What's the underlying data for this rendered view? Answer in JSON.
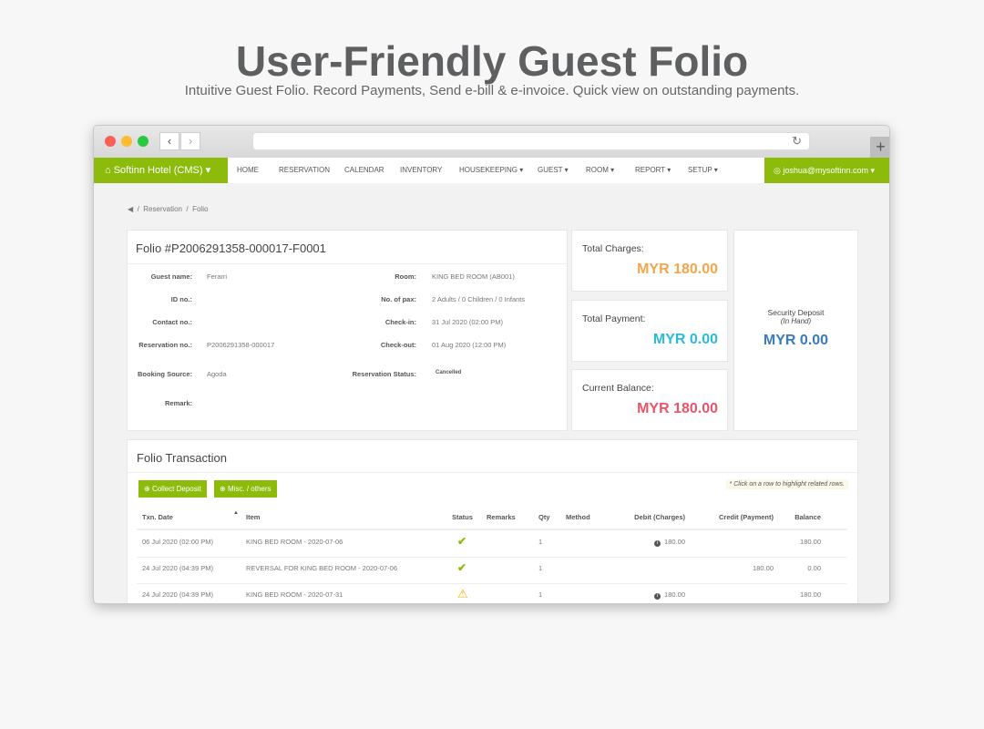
{
  "headline": "User-Friendly Guest Folio",
  "subheadline": "Intuitive Guest Folio. Record Payments, Send e-bill & e-invoice. Quick view on outstanding payments.",
  "nav": {
    "brand": "Softinn Hotel (CMS)",
    "items": [
      "HOME",
      "RESERVATION",
      "CALENDAR",
      "INVENTORY",
      "HOUSEKEEPING ▾",
      "GUEST ▾",
      "ROOM ▾",
      "REPORT ▾",
      "SETUP ▾"
    ],
    "user": "joshua@mysoftinn.com"
  },
  "breadcrumb": {
    "items": [
      "Reservation",
      "Folio"
    ]
  },
  "folio": {
    "title": "Folio #P2006291358-000017-F0001",
    "left": [
      {
        "label": "Guest name:",
        "value": "Ferarri"
      },
      {
        "label": "ID no.:",
        "value": ""
      },
      {
        "label": "Contact no.:",
        "value": ""
      },
      {
        "label": "Reservation no.:",
        "value": "P2006291358-000017"
      },
      {
        "label": "Booking Source:",
        "value": "Agoda"
      },
      {
        "label": "Remark:",
        "value": ""
      }
    ],
    "right": [
      {
        "label": "Room:",
        "value": "KING BED ROOM (AB001)"
      },
      {
        "label": "No. of pax:",
        "value": "2 Adults / 0 Children / 0 Infants"
      },
      {
        "label": "Check-in:",
        "value": "31 Jul 2020 (02:00 PM)"
      },
      {
        "label": "Check-out:",
        "value": "01 Aug 2020 (12:00 PM)"
      },
      {
        "label": "Reservation Status:",
        "value": "Cancelled"
      }
    ]
  },
  "summary": {
    "total_charges": {
      "label": "Total Charges:",
      "value": "MYR 180.00",
      "color": "#f5a54a"
    },
    "total_payment": {
      "label": "Total Payment:",
      "value": "MYR 0.00",
      "color": "#2bbbd8"
    },
    "current_balance": {
      "label": "Current Balance:",
      "value": "MYR 180.00",
      "color": "#e8556a"
    },
    "security_deposit": {
      "label": "Security Deposit",
      "sublabel": "(In Hand)",
      "value": "MYR 0.00",
      "color": "#3a7bbf"
    }
  },
  "transactions": {
    "title": "Folio Transaction",
    "collect_deposit": "Collect Deposit",
    "misc": "Misc. / others",
    "hint": "* Click on a row to highlight related rows.",
    "columns": [
      "Txn. Date",
      "Item",
      "Status",
      "Remarks",
      "Qty",
      "Method",
      "Debit (Charges)",
      "Credit (Payment)",
      "Balance"
    ],
    "rows": [
      {
        "date": "06 Jul 2020 (02:00 PM)",
        "item": "KING BED ROOM - 2020-07-06",
        "status": "check",
        "remarks": "",
        "qty": "1",
        "method": "",
        "debit": "180.00",
        "credit": "",
        "balance": "180.00"
      },
      {
        "date": "24 Jul 2020 (04:39 PM)",
        "item": "REVERSAL FOR KING BED ROOM - 2020-07-06",
        "status": "check",
        "remarks": "",
        "qty": "1",
        "method": "",
        "debit": "",
        "credit": "180.00",
        "balance": "0.00"
      },
      {
        "date": "24 Jul 2020 (04:39 PM)",
        "item": "KING BED ROOM - 2020-07-31",
        "status": "warning",
        "remarks": "",
        "qty": "1",
        "method": "",
        "debit": "180.00",
        "credit": "",
        "balance": "180.00"
      }
    ]
  },
  "colors": {
    "accent": "#8cbb0c"
  }
}
